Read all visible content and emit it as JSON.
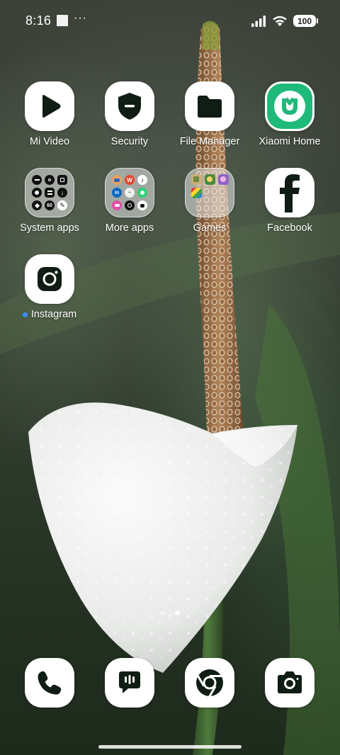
{
  "status_bar": {
    "time": "8:16",
    "more": "···",
    "battery": "100"
  },
  "apps": [
    {
      "label": "Mi Video",
      "icon": "play-icon"
    },
    {
      "label": "Security",
      "icon": "shield-icon"
    },
    {
      "label": "File Manager",
      "icon": "folder-icon"
    },
    {
      "label": "Xiaomi Home",
      "icon": "xiaomi-home-icon"
    },
    {
      "label": "System apps",
      "icon": "folder-icon"
    },
    {
      "label": "More apps",
      "icon": "folder-icon"
    },
    {
      "label": "Games",
      "icon": "folder-icon"
    },
    {
      "label": "Facebook",
      "icon": "facebook-icon"
    },
    {
      "label": "Instagram",
      "icon": "instagram-icon",
      "new_install": true
    }
  ],
  "dock": [
    {
      "name": "Phone",
      "icon": "phone-icon"
    },
    {
      "name": "Messages",
      "icon": "message-icon"
    },
    {
      "name": "Chrome",
      "icon": "chrome-icon"
    },
    {
      "name": "Camera",
      "icon": "camera-icon"
    }
  ],
  "page_indicator": {
    "pages": 2,
    "active": 2
  },
  "colors": {
    "icon_bg": "#ffffff",
    "icon_glyph": "#0f1d14",
    "xiaomi_home_green": "#1fb97a",
    "new_dot": "#3a8cff"
  }
}
